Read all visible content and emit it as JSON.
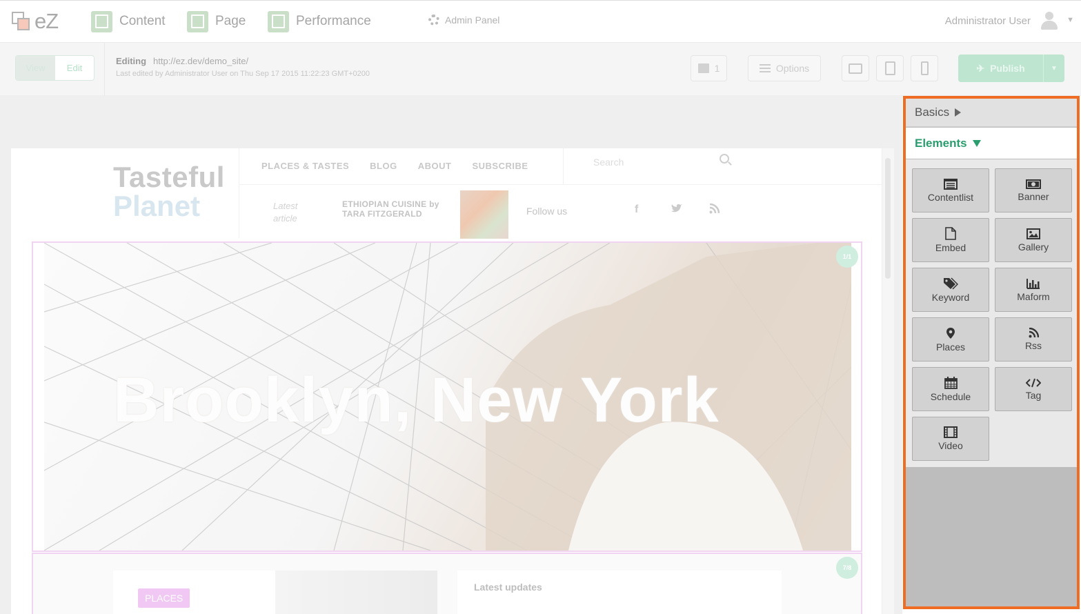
{
  "topnav": {
    "logo_text": "eZ",
    "items": [
      {
        "label": "Content",
        "icon": "content-icon"
      },
      {
        "label": "Page",
        "icon": "page-icon"
      },
      {
        "label": "Performance",
        "icon": "performance-icon"
      }
    ],
    "admin_panel": "Admin Panel",
    "user": "Administrator User"
  },
  "toolbar": {
    "view_label": "View",
    "edit_label": "Edit",
    "editing_label": "Editing",
    "editing_url": "http://ez.dev/demo_site/",
    "last_edited": "Last edited by Administrator User on Thu Sep 17 2015 11:22:23 GMT+0200",
    "drafts_count": "1",
    "options_label": "Options",
    "publish_label": "Publish"
  },
  "site": {
    "brand_line1": "Tasteful",
    "brand_line2": "Planet",
    "nav": [
      "PLACES & TASTES",
      "BLOG",
      "ABOUT",
      "SUBSCRIBE"
    ],
    "search_placeholder": "Search",
    "latest_label_1": "Latest",
    "latest_label_2": "article",
    "latest_article": "ETHIOPIAN CUISINE by TARA FITZGERALD",
    "follow_us": "Follow us",
    "hero_title": "Brooklyn, New York",
    "hero_badge": "1/1",
    "block2_badge": "7/8",
    "places_tag": "PLACES",
    "latest_updates": "Latest updates"
  },
  "panel": {
    "basics_label": "Basics",
    "elements_label": "Elements",
    "tiles": [
      {
        "label": "Contentlist",
        "icon": "contentlist-icon"
      },
      {
        "label": "Banner",
        "icon": "banner-icon"
      },
      {
        "label": "Embed",
        "icon": "embed-icon"
      },
      {
        "label": "Gallery",
        "icon": "gallery-icon"
      },
      {
        "label": "Keyword",
        "icon": "keyword-icon"
      },
      {
        "label": "Maform",
        "icon": "maform-icon"
      },
      {
        "label": "Places",
        "icon": "places-icon"
      },
      {
        "label": "Rss",
        "icon": "rss-icon"
      },
      {
        "label": "Schedule",
        "icon": "schedule-icon"
      },
      {
        "label": "Tag",
        "icon": "tag-icon"
      },
      {
        "label": "Video",
        "icon": "video-icon"
      }
    ]
  },
  "colors": {
    "highlight": "#ef6c25",
    "accent_green": "#2a9d6f",
    "block_border": "#f0d4f2"
  }
}
